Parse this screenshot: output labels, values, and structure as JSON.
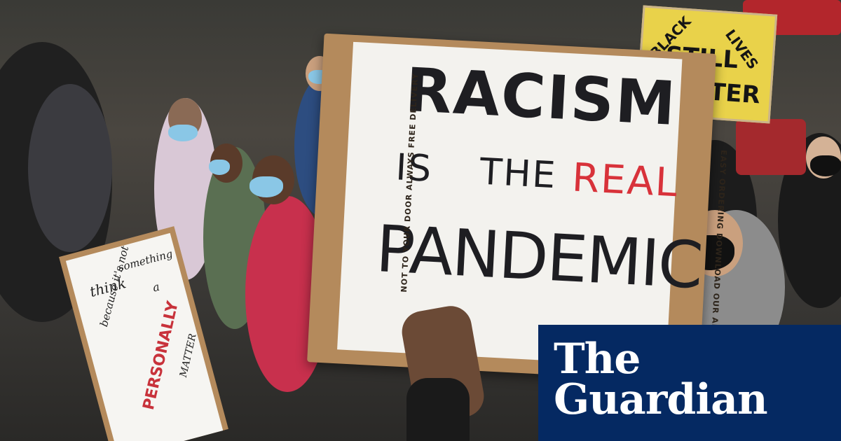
{
  "photo": {
    "main_sign": {
      "line1": "RACISM",
      "line2a": "IS",
      "line2b": "THE",
      "line2c": "REAL",
      "line3": "PANDEMIC",
      "box_print_left": "NOT TO YOUR DOOR ALWAYS FREE DELIVERY",
      "box_print_right": "EASY ORDERING DOWNLOAD OUR APP NOW"
    },
    "left_sign": {
      "l1": "think",
      "l2": "something",
      "l3": "because it's not",
      "l4": "a",
      "l5": "PERSONALLY",
      "l6": "MATTER"
    },
    "yellow_sign": {
      "l1": "BLACK",
      "l2": "LIVES",
      "l3": "STILL",
      "l4": "TER"
    }
  },
  "brand": {
    "line1": "The",
    "line2": "Guardian"
  },
  "colors": {
    "brand_bg": "#052962",
    "sign_red": "#d8323a",
    "sign_ink": "#1e1e22",
    "yellow_sign": "#e9d24a"
  }
}
